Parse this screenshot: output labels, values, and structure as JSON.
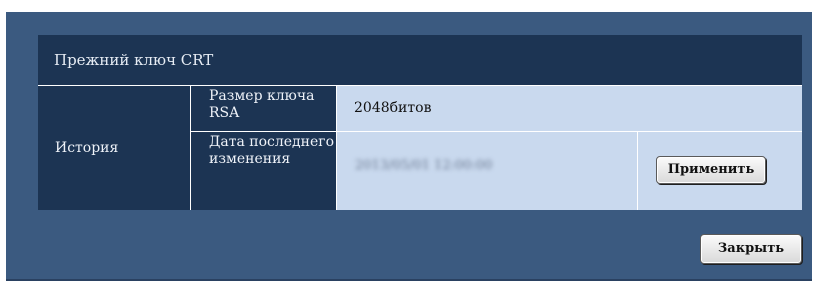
{
  "section": {
    "title": "Прежний ключ CRT"
  },
  "history": {
    "label": "История"
  },
  "rsa": {
    "label": "Размер ключа RSA",
    "value": "2048битов"
  },
  "last_modified": {
    "label": "Дата последнего изменения",
    "value": "2013/05/01 12:00:00"
  },
  "buttons": {
    "apply": "Применить",
    "close": "Закрыть"
  }
}
